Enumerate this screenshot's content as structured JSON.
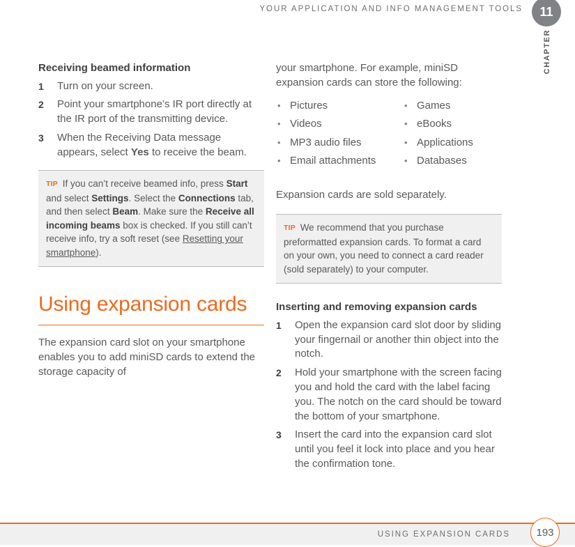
{
  "header": {
    "running_head": "YOUR APPLICATION AND INFO MANAGEMENT TOOLS",
    "chapter_word": "CHAPTER",
    "chapter_number": "11"
  },
  "left_column": {
    "subhead": "Receiving beamed information",
    "steps": [
      {
        "num": "1",
        "text": "Turn on your screen."
      },
      {
        "num": "2",
        "text": "Point your smartphone’s IR port directly at the IR port of the transmitting device."
      },
      {
        "num": "3",
        "pre": "When the Receiving Data message appears, select ",
        "bold": "Yes",
        "post": " to receive the beam."
      }
    ],
    "tip": {
      "label": "TIP",
      "seg1": " If you can’t receive beamed info, press ",
      "b1": "Start",
      "seg2": " and select ",
      "b2": "Settings",
      "seg3": ". Select the ",
      "b3": "Connections",
      "seg4": " tab, and then select ",
      "b4": "Beam",
      "seg5": ". Make sure the ",
      "b5": "Receive all incoming beams",
      "seg6": " box is checked. If you still can’t receive info, try a soft reset (see ",
      "link": "Resetting your smartphone",
      "seg7": ")."
    },
    "section_title": "Using expansion cards",
    "section_paragraph": "The expansion card slot on your smartphone enables you to add miniSD cards to extend the storage capacity of"
  },
  "right_column": {
    "intro_paragraph": "your smartphone. For example, miniSD expansion cards can store the following:",
    "bullets_col_a": [
      "Pictures",
      "Videos",
      "MP3 audio files",
      "Email attachments"
    ],
    "bullets_col_b": [
      "Games",
      "eBooks",
      "Applications",
      "Databases"
    ],
    "note_paragraph": "Expansion cards are sold separately.",
    "tip": {
      "label": "TIP",
      "text": " We recommend that you purchase preformatted expansion cards. To format a card on your own, you need to connect a card reader (sold separately) to your computer."
    },
    "subhead": "Inserting and removing expansion cards",
    "steps": [
      {
        "num": "1",
        "text": "Open the expansion card slot door by sliding your fingernail or another thin object into the notch."
      },
      {
        "num": "2",
        "text": "Hold your smartphone with the screen facing you and hold the card with the label facing you. The notch on the card should be toward the bottom of your smartphone."
      },
      {
        "num": "3",
        "text": "Insert the card into the expansion card slot until you feel it lock into place and you hear the confirmation tone."
      }
    ]
  },
  "footer": {
    "title": "USING EXPANSION CARDS",
    "page_number": "193"
  },
  "colors": {
    "accent_orange": "#ee6a1e",
    "body_gray": "#58595b",
    "tip_background": "#f0f0f0",
    "badge_gray": "#808285"
  }
}
